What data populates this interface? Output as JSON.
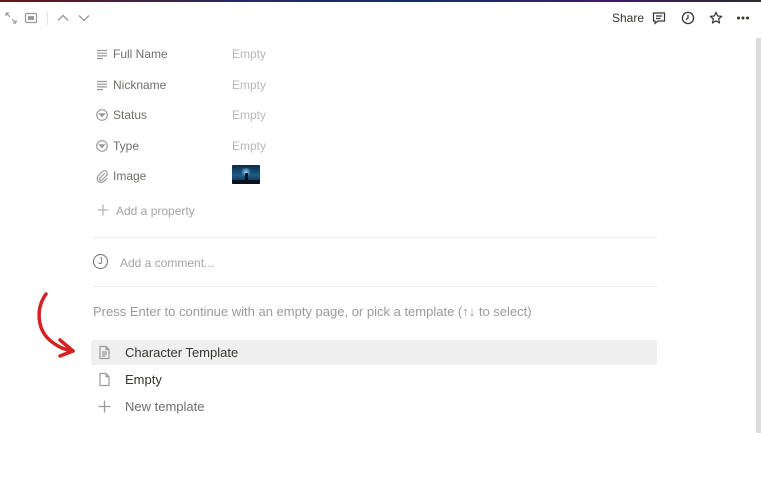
{
  "header": {
    "share_label": "Share",
    "icons": [
      "expand-icon",
      "peek-mode-icon",
      "chevron-up-icon",
      "chevron-down-icon",
      "comment-icon",
      "clock-icon",
      "star-icon",
      "more-icon"
    ]
  },
  "properties": [
    {
      "label": "Full Name",
      "value": "Empty",
      "icon": "text-lines-icon"
    },
    {
      "label": "Nickname",
      "value": "Empty",
      "icon": "text-lines-icon"
    },
    {
      "label": "Status",
      "value": "Empty",
      "icon": "select-icon"
    },
    {
      "label": "Type",
      "value": "Empty",
      "icon": "select-icon"
    },
    {
      "label": "Image",
      "value": "",
      "icon": "paperclip-icon"
    }
  ],
  "add_property_label": "Add a property",
  "comment": {
    "avatar_letter": "J",
    "placeholder": "Add a comment..."
  },
  "template_hint": "Press Enter to continue with an empty page, or pick a template (↑↓ to select)",
  "templates": [
    {
      "label": "Character Template",
      "icon": "document-icon",
      "selected": true
    },
    {
      "label": "Empty",
      "icon": "blank-page-icon",
      "selected": false
    },
    {
      "label": "New template",
      "icon": "plus-icon",
      "selected": false
    }
  ],
  "colors": {
    "text": "#37352f",
    "muted": "#9b9a97",
    "selected_bg": "#efefef",
    "annotation_arrow": "#d42222"
  }
}
